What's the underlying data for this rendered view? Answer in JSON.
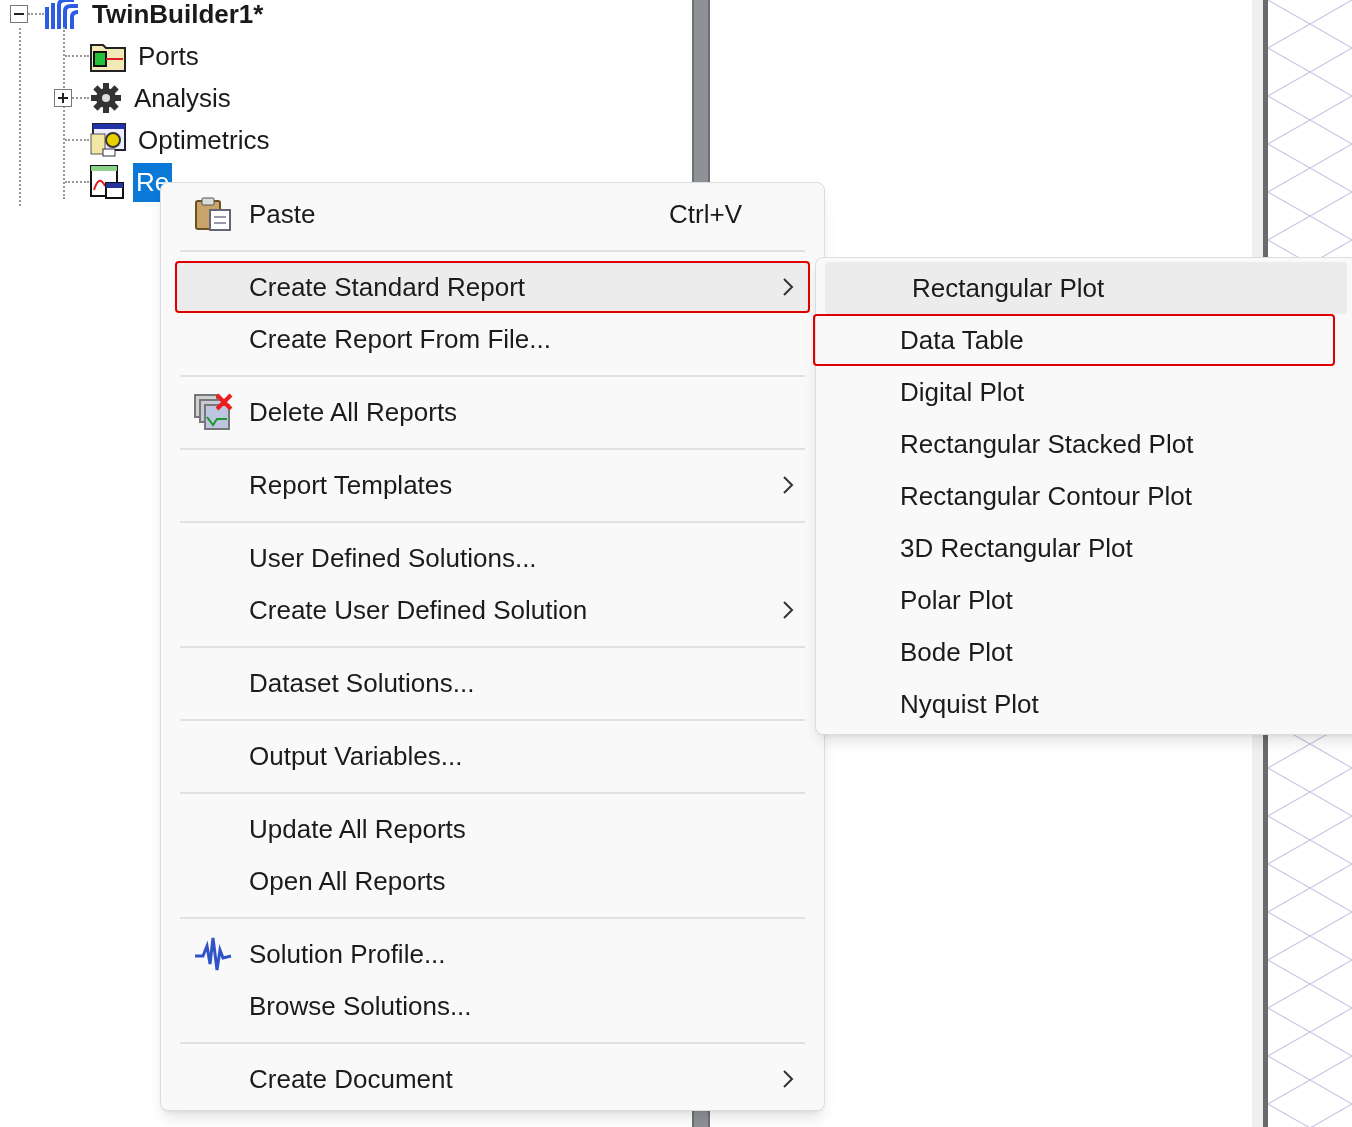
{
  "tree": {
    "label": "TwinBuilder1*",
    "expanded": true,
    "children": [
      {
        "label": "Ports",
        "kind": "ports",
        "collapsed": false,
        "selected": false
      },
      {
        "label": "Analysis",
        "kind": "gear",
        "collapsed": true,
        "selected": false
      },
      {
        "label": "Optimetrics",
        "kind": "optimetrics",
        "collapsed": false,
        "selected": false
      },
      {
        "label": "Re",
        "kind": "results",
        "collapsed": false,
        "selected": true
      }
    ]
  },
  "context_menu": {
    "groups": [
      [
        {
          "label": "Paste",
          "kind": "paste",
          "shortcut": "Ctrl+V",
          "submenu": false,
          "highlighted": false,
          "annotated": false
        }
      ],
      [
        {
          "label": "Create Standard Report",
          "submenu": true,
          "highlighted": true,
          "annotated": true
        },
        {
          "label": "Create Report From File...",
          "submenu": false,
          "highlighted": false,
          "annotated": false
        }
      ],
      [
        {
          "label": "Delete All Reports",
          "kind": "delete_reports",
          "submenu": false,
          "highlighted": false,
          "annotated": false
        }
      ],
      [
        {
          "label": "Report Templates",
          "submenu": true,
          "highlighted": false,
          "annotated": false
        }
      ],
      [
        {
          "label": "User Defined Solutions...",
          "submenu": false,
          "highlighted": false,
          "annotated": false
        },
        {
          "label": "Create User Defined Solution",
          "submenu": true,
          "highlighted": false,
          "annotated": false
        }
      ],
      [
        {
          "label": "Dataset Solutions...",
          "submenu": false,
          "highlighted": false,
          "annotated": false
        }
      ],
      [
        {
          "label": "Output Variables...",
          "submenu": false,
          "highlighted": false,
          "annotated": false
        }
      ],
      [
        {
          "label": "Update All Reports",
          "submenu": false,
          "highlighted": false,
          "annotated": false
        },
        {
          "label": "Open All Reports",
          "submenu": false,
          "highlighted": false,
          "annotated": false
        }
      ],
      [
        {
          "label": "Solution Profile...",
          "kind": "waveform",
          "submenu": false,
          "highlighted": false,
          "annotated": false
        },
        {
          "label": "Browse Solutions...",
          "submenu": false,
          "highlighted": false,
          "annotated": false
        }
      ],
      [
        {
          "label": "Create Document",
          "submenu": true,
          "highlighted": false,
          "annotated": false
        }
      ]
    ]
  },
  "submenu": {
    "items": [
      {
        "label": "Rectangular Plot",
        "highlighted": true,
        "annotated": false
      },
      {
        "label": "Data Table",
        "highlighted": false,
        "annotated": true
      },
      {
        "label": "Digital Plot",
        "highlighted": false,
        "annotated": false
      },
      {
        "label": "Rectangular Stacked Plot",
        "highlighted": false,
        "annotated": false
      },
      {
        "label": "Rectangular Contour Plot",
        "highlighted": false,
        "annotated": false
      },
      {
        "label": "3D Rectangular Plot",
        "highlighted": false,
        "annotated": false
      },
      {
        "label": "Polar Plot",
        "highlighted": false,
        "annotated": false
      },
      {
        "label": "Bode Plot",
        "highlighted": false,
        "annotated": false
      },
      {
        "label": "Nyquist Plot",
        "highlighted": false,
        "annotated": false
      }
    ]
  }
}
